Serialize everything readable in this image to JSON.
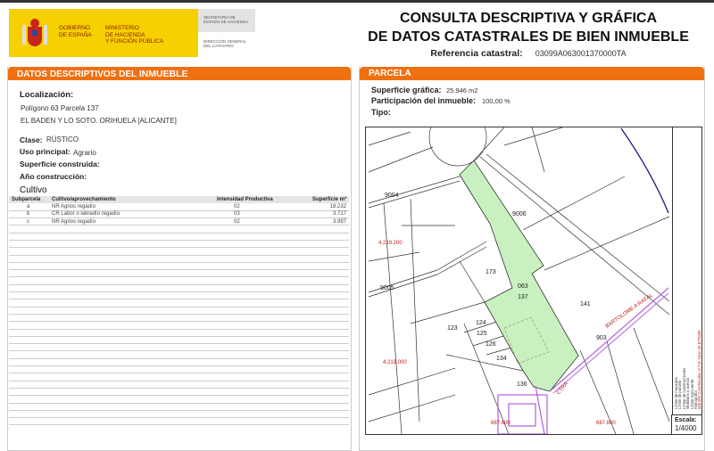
{
  "header": {
    "gov_line1": "GOBIERNO",
    "gov_line2": "DE ESPAÑA",
    "min_line1": "MINISTERIO",
    "min_line2": "DE HACIENDA",
    "min_line3": "Y FUNCIÓN PÚBLICA",
    "secretaria": "SECRETARÍA DE ESTADO DE HACIENDA",
    "direccion": "DIRECCIÓN GENERAL DEL CATASTRO",
    "title_line1": "CONSULTA DESCRIPTIVA Y GRÁFICA",
    "title_line2": "DE DATOS CATASTRALES DE BIEN INMUEBLE",
    "ref_label": "Referencia catastral:",
    "ref_value": "03099A063001370000TA"
  },
  "colors": {
    "accent": "#f07010",
    "logo_yellow": "#f6d000",
    "parcel_green": "#c8f0c0",
    "road_purple": "#b060e0",
    "river_blue": "#1a1a8a"
  },
  "left": {
    "header_prefix": "DATOS DESCRIPTIVOS DEL ",
    "header_bold": "INMUEBLE",
    "loc_label": "Localización:",
    "loc_line1": "Polígono 63 Parcela 137",
    "loc_line2": "EL BADEN Y LO SOTO. ORIHUELA [ALICANTE]",
    "clase_label": "Clase:",
    "clase_value": "RÚSTICO",
    "uso_label": "Uso principal:",
    "uso_value": "Agrario",
    "sup_label": "Superficie construida:",
    "anio_label": "Año construcción:",
    "cultivo_label": "Cultivo",
    "columns": [
      "Subparcela",
      "Cultivo/aprovechamiento",
      "Intensidad Productiva",
      "Superficie m²"
    ],
    "rows": [
      [
        "a",
        "NR Agrios regadío",
        "02",
        "18.232"
      ],
      [
        "b",
        "CR Labor o labradío regadío",
        "03",
        "3.717"
      ],
      [
        "c",
        "NR Agrios regadío",
        "02",
        "3.997"
      ]
    ]
  },
  "right": {
    "header": "PARCELA",
    "sup_label": "Superficie gráfica:",
    "sup_value": "25.946 m2",
    "part_label": "Participación del inmueble:",
    "part_value": "100,00 %",
    "tipo_label": "Tipo:"
  },
  "map": {
    "labels": {
      "p9004": "9004",
      "p9006": "9006",
      "p9005": "9005",
      "p173": "173",
      "p063": "063",
      "p137": "137",
      "p141": "141",
      "p123": "123",
      "p124": "124",
      "p125": "125",
      "p126": "126",
      "p134": "134",
      "p136": "136",
      "p903": "903",
      "y1": "4.219.200",
      "y2": "4.219.000",
      "x1": "687.600",
      "x2": "687.800",
      "road1": "CTRA",
      "road2": "BARTOLOME A RAFAL"
    },
    "legend": [
      "Límite de manzana",
      "Límite de parcela",
      "Límite de construcciones",
      "Mobiliario y aceras",
      "Límite zona verde",
      "Hidrografía",
      "688.000 Coordenadas U.T.M. Huso 30 ETRS89"
    ],
    "scale_label": "Escala:",
    "scale_value": "1/4000"
  }
}
